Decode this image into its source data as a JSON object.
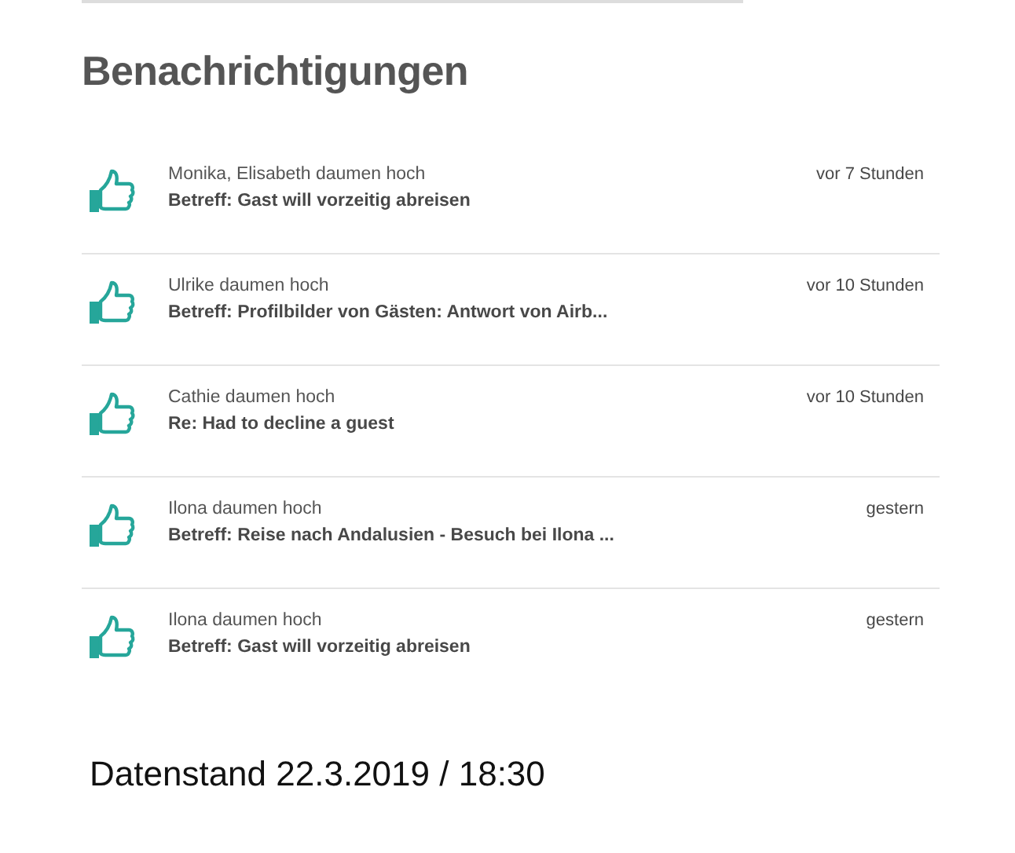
{
  "title": "Benachrichtigungen",
  "notifications": [
    {
      "who": "Monika, Elisabeth daumen hoch",
      "subject": "Betreff: Gast will vorzeitig abreisen",
      "time": "vor 7 Stunden"
    },
    {
      "who": "Ulrike daumen hoch",
      "subject": "Betreff: Profilbilder von Gästen: Antwort von Airb...",
      "time": "vor 10 Stunden"
    },
    {
      "who": "Cathie daumen hoch",
      "subject": "Re: Had to decline a guest",
      "time": "vor 10 Stunden"
    },
    {
      "who": "Ilona daumen hoch",
      "subject": "Betreff: Reise nach Andalusien - Besuch bei Ilona ...",
      "time": "gestern"
    },
    {
      "who": "Ilona daumen hoch",
      "subject": "Betreff: Gast will vorzeitig abreisen",
      "time": "gestern"
    }
  ],
  "footer": "Datenstand 22.3.2019 / 18:30"
}
